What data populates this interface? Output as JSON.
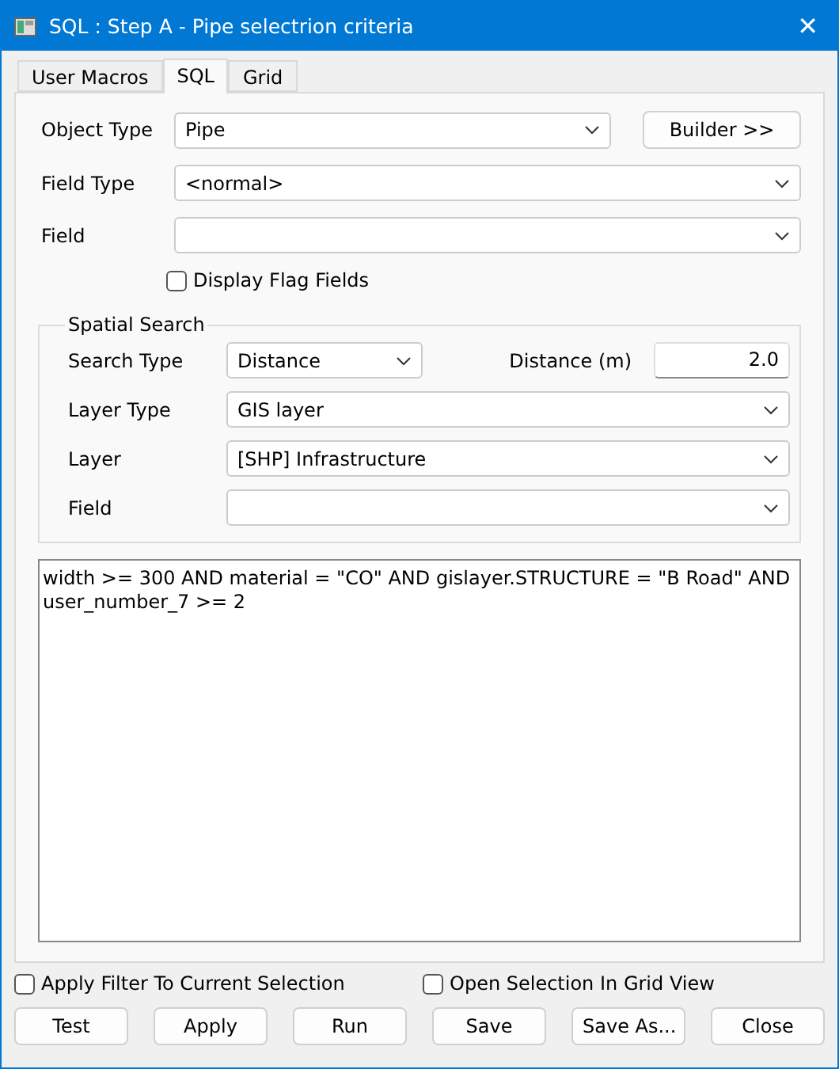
{
  "window": {
    "title": "SQL : Step A - Pipe selectrion criteria",
    "close": "✕"
  },
  "tabs": [
    {
      "label": "User Macros",
      "selected": false
    },
    {
      "label": "SQL",
      "selected": true
    },
    {
      "label": "Grid",
      "selected": false
    }
  ],
  "object_type": {
    "label": "Object Type",
    "value": "Pipe"
  },
  "builder_button": "Builder >>",
  "field_type": {
    "label": "Field Type",
    "value": "<normal>"
  },
  "field": {
    "label": "Field"
  },
  "display_flag_fields": {
    "label": "Display Flag Fields",
    "checked": false
  },
  "spatial_search": {
    "title": "Spatial Search",
    "search_type": {
      "label": "Search Type",
      "value": "Distance"
    },
    "distance": {
      "label": "Distance (m)",
      "value": "2.0"
    },
    "layer_type": {
      "label": "Layer Type",
      "value": "GIS layer"
    },
    "layer": {
      "label": "Layer",
      "value": "[SHP] Infrastructure"
    },
    "field": {
      "label": "Field"
    }
  },
  "query": "width >= 300 AND material = \"CO\" AND gislayer.STRUCTURE = \"B Road\" AND user_number_7 >= 2",
  "options": [
    {
      "label": "Apply Filter To Current Selection",
      "checked": false
    },
    {
      "label": "Open Selection In Grid View",
      "checked": false
    }
  ],
  "buttons": [
    "Test",
    "Apply",
    "Run",
    "Save",
    "Save As...",
    "Close"
  ]
}
